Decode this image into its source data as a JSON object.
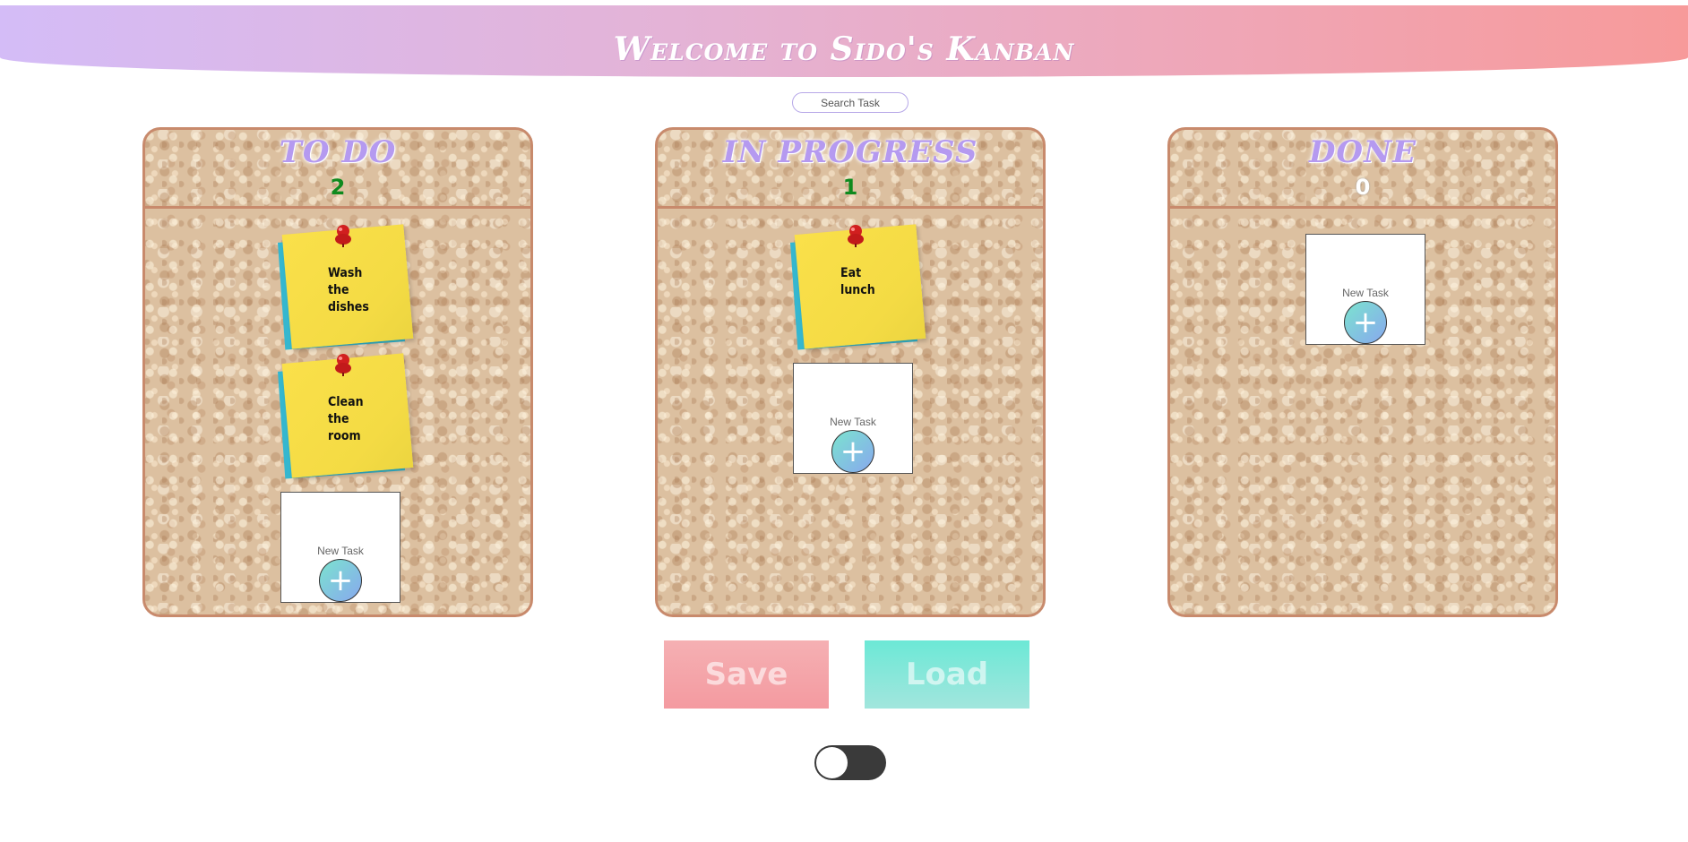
{
  "header": {
    "title": "Welcome to Sido's Kanban"
  },
  "search": {
    "placeholder": "Search Task"
  },
  "boards": [
    {
      "title": "TO DO",
      "count": "2",
      "notes": [
        "Wash the dishes",
        "Clean the room"
      ],
      "new_task_label": "New Task",
      "add_label": "+"
    },
    {
      "title": "IN PROGRESS",
      "count": "1",
      "notes": [
        "Eat lunch"
      ],
      "new_task_label": "New Task",
      "add_label": "+"
    },
    {
      "title": "DONE",
      "count": "0",
      "notes": [],
      "new_task_label": "New Task",
      "add_label": "+"
    }
  ],
  "actions": {
    "save_label": "Save",
    "load_label": "Load"
  },
  "theme_toggle": {
    "on": false
  },
  "colors": {
    "board_border": "#c88a6c",
    "board_title": "#b59af0",
    "count": "#0f8a1e",
    "note_yellow": "#f4db44",
    "note_blue": "#35b7cf",
    "save": "#f49aa0",
    "load": "#6ce8d6"
  }
}
